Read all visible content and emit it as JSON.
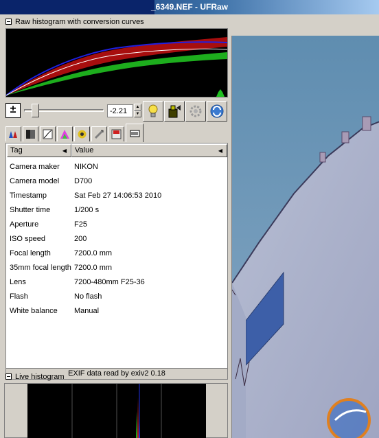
{
  "window": {
    "title": "_6349.NEF - UFRaw"
  },
  "raw_histogram": {
    "header": "Raw histogram with conversion curves"
  },
  "exposure": {
    "value": "-2.21"
  },
  "toolbar": {
    "auto_exposure_icon": "bulb-icon",
    "detect_clipping_icon": "clipping-icon",
    "settings_icon": "gear-icon",
    "refresh_icon": "refresh-icon"
  },
  "tabs": [
    {
      "name": "tab-white-balance",
      "icon": "wb-icon"
    },
    {
      "name": "tab-grayscale",
      "icon": "grayscale-icon"
    },
    {
      "name": "tab-base-curve",
      "icon": "curve-icon"
    },
    {
      "name": "tab-color-management",
      "icon": "color-icon"
    },
    {
      "name": "tab-corrections",
      "icon": "lens-icon"
    },
    {
      "name": "tab-transform",
      "icon": "crop-icon"
    },
    {
      "name": "tab-save",
      "icon": "save-icon"
    },
    {
      "name": "tab-exif",
      "icon": "exif-icon",
      "active": true
    }
  ],
  "exif": {
    "columns": {
      "tag": "Tag",
      "value": "Value"
    },
    "rows": [
      {
        "tag": "Camera maker",
        "value": "NIKON"
      },
      {
        "tag": "Camera model",
        "value": "D700"
      },
      {
        "tag": "Timestamp",
        "value": "Sat Feb 27 14:06:53 2010"
      },
      {
        "tag": "Shutter time",
        "value": "1/200 s"
      },
      {
        "tag": "Aperture",
        "value": "F25"
      },
      {
        "tag": "ISO speed",
        "value": "200"
      },
      {
        "tag": "Focal length",
        "value": "7200.0 mm"
      },
      {
        "tag": "35mm focal length",
        "value": "7200.0 mm"
      },
      {
        "tag": "Lens",
        "value": "7200-480mm F25-36"
      },
      {
        "tag": "Flash",
        "value": "No flash"
      },
      {
        "tag": "White balance",
        "value": "Manual"
      }
    ],
    "status": "EXIF data read by exiv2 0.18"
  },
  "live_histogram": {
    "header": "Live histogram"
  },
  "colors": {
    "titlebar": "#0a246a",
    "panel": "#d4d0c8",
    "curve_red": "#c41010",
    "curve_green": "#20c020",
    "curve_blue": "#2020e0"
  }
}
